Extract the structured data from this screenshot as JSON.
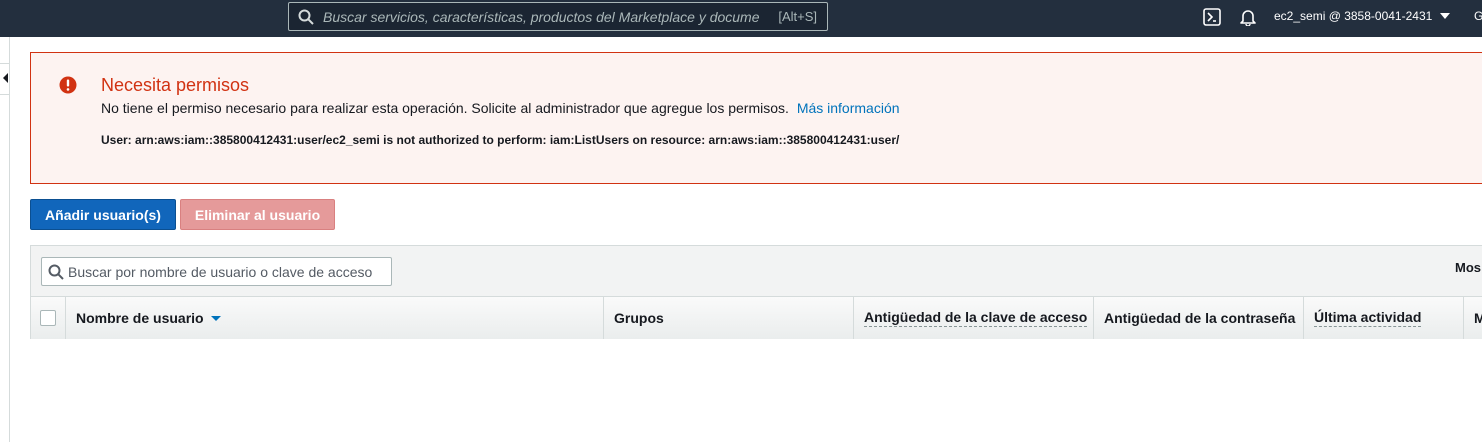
{
  "topbar": {
    "search_placeholder": "Buscar servicios, características, productos del Marketplace y docume",
    "search_shortcut": "[Alt+S]",
    "account": "ec2_semi @ 3858-0041-2431",
    "region_initial": "G",
    "icons": [
      "search-icon",
      "cloudshell-icon",
      "bell-icon",
      "caret-down-icon"
    ],
    "bg_color": "#232f3e"
  },
  "alert": {
    "title": "Necesita permisos",
    "message": "No tiene el permiso necesario para realizar esta operación. Solicite al administrador que agregue los permisos.",
    "link": "Más información",
    "detail": "User: arn:aws:iam::385800412431:user/ec2_semi is not authorized to perform: iam:ListUsers on resource: arn:aws:iam::385800412431:user/",
    "color": "#d13212"
  },
  "actions": {
    "add_user": "Añadir usuario(s)",
    "delete_user": "Eliminar al usuario"
  },
  "table": {
    "filter_placeholder": "Buscar por nombre de usuario o clave de acceso",
    "show_label": "Mos",
    "columns": {
      "username": "Nombre de usuario",
      "groups": "Grupos",
      "access_key_age": "Antigüedad de la clave de acceso",
      "password_age": "Antigüedad de la contraseña",
      "last_activity": "Última actividad",
      "next": "M"
    }
  }
}
